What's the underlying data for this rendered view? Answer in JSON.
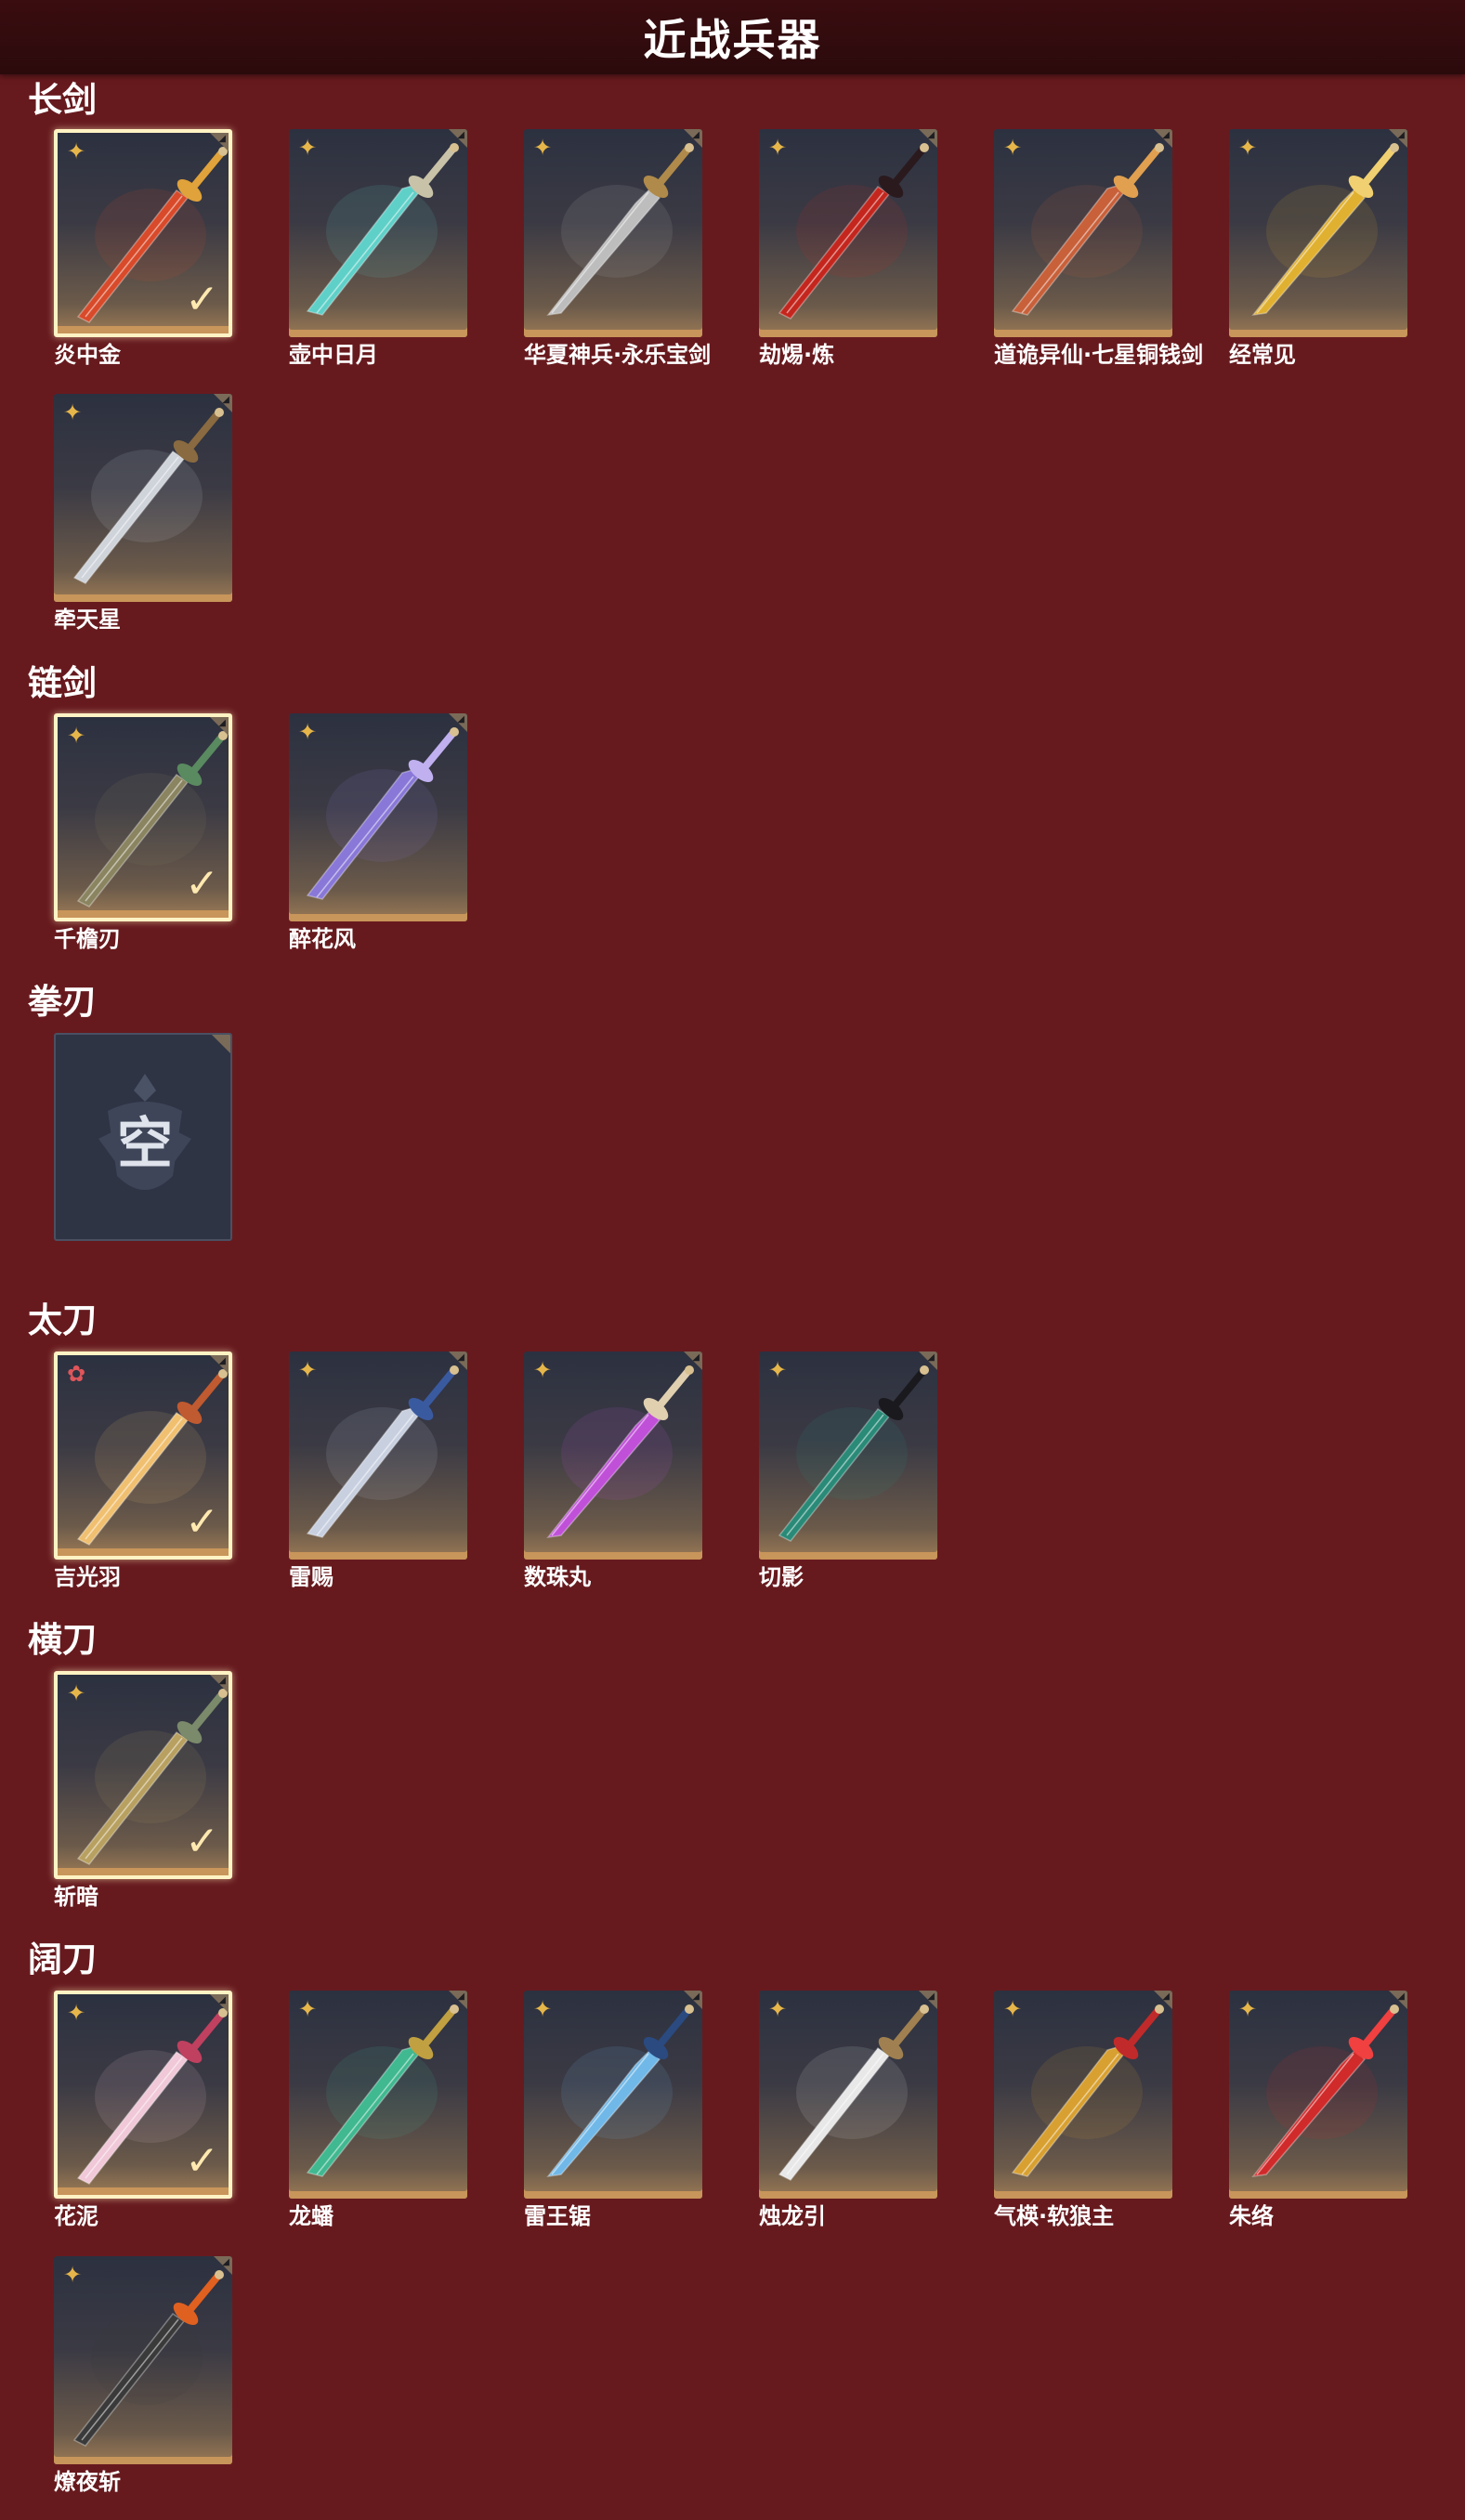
{
  "header": {
    "title": "近战兵器"
  },
  "sections": {
    "longsword": {
      "title": "长剑",
      "items": [
        {
          "name": "炎中金",
          "selected": true,
          "rarity": "gold",
          "blade": "#d84a2a",
          "guard": "#e0a23a"
        },
        {
          "name": "壶中日月",
          "selected": false,
          "rarity": "gold",
          "blade": "#5fd0c8",
          "guard": "#c8c2a8"
        },
        {
          "name": "华夏神兵·永乐宝剑",
          "selected": false,
          "rarity": "gold",
          "blade": "#bdbdbd",
          "guard": "#b08a4a"
        },
        {
          "name": "劫焬·炼",
          "selected": false,
          "rarity": "gold",
          "blade": "#c4261e",
          "guard": "#2a1a1e"
        },
        {
          "name": "道诡异仙·七星铜钱剑",
          "selected": false,
          "rarity": "gold",
          "blade": "#c8603a",
          "guard": "#e0a050"
        },
        {
          "name": "经常见",
          "selected": false,
          "rarity": "gold",
          "blade": "#e0b030",
          "guard": "#f0d070"
        },
        {
          "name": "牵天星",
          "selected": false,
          "rarity": "gold",
          "blade": "#cfd3da",
          "guard": "#8a6a40"
        }
      ]
    },
    "chainsword": {
      "title": "链剑",
      "items": [
        {
          "name": "千檐刃",
          "selected": true,
          "rarity": "gold",
          "blade": "#8a8460",
          "guard": "#5a8a60"
        },
        {
          "name": "醉花风",
          "selected": false,
          "rarity": "gold",
          "blade": "#8a78d8",
          "guard": "#c0b0f0"
        }
      ]
    },
    "fistblade": {
      "title": "拳刃",
      "empty_label": "空"
    },
    "tachi": {
      "title": "太刀",
      "items": [
        {
          "name": "吉光羽",
          "selected": true,
          "rarity": "red",
          "blade": "#f0c070",
          "guard": "#c05a30"
        },
        {
          "name": "雷赐",
          "selected": false,
          "rarity": "gold",
          "blade": "#c8d0e0",
          "guard": "#3a5aa0"
        },
        {
          "name": "数珠丸",
          "selected": false,
          "rarity": "gold",
          "blade": "#c050d8",
          "guard": "#e0d0b0"
        },
        {
          "name": "切影",
          "selected": false,
          "rarity": "gold",
          "blade": "#2a8a78",
          "guard": "#1a1a1e"
        }
      ]
    },
    "hengdao": {
      "title": "横刀",
      "items": [
        {
          "name": "斩暗",
          "selected": true,
          "rarity": "gold",
          "blade": "#b8a060",
          "guard": "#7a8a6a"
        }
      ]
    },
    "kuodao": {
      "title": "阔刀",
      "items": [
        {
          "name": "花泥",
          "selected": true,
          "rarity": "gold",
          "blade": "#f0c8d8",
          "guard": "#c04060"
        },
        {
          "name": "龙蟠",
          "selected": false,
          "rarity": "gold",
          "blade": "#40b890",
          "guard": "#c0a040"
        },
        {
          "name": "雷王锯",
          "selected": false,
          "rarity": "gold",
          "blade": "#70b8e8",
          "guard": "#2a4a80"
        },
        {
          "name": "烛龙引",
          "selected": false,
          "rarity": "gold",
          "blade": "#e8e8e8",
          "guard": "#a08050"
        },
        {
          "name": "气楧·软狼主",
          "selected": false,
          "rarity": "gold",
          "blade": "#d8a030",
          "guard": "#c02a2a"
        },
        {
          "name": "朱络",
          "selected": false,
          "rarity": "gold",
          "blade": "#d02a2a",
          "guard": "#f04040"
        },
        {
          "name": "燎夜斩",
          "selected": false,
          "rarity": "gold",
          "blade": "#3a3a3a",
          "guard": "#e06020"
        }
      ]
    }
  },
  "icons": {
    "rarity_gold": "four-point-star-icon",
    "rarity_red": "sakura-star-icon",
    "selected": "checkmark-icon"
  },
  "colors": {
    "background": "#671a1e",
    "header": "#2b0a0c",
    "rarity_gold": "#e6b64a",
    "rarity_red": "#e0555a",
    "tile_bottom": "#c8955a",
    "selected_border": "#fff3c4"
  }
}
